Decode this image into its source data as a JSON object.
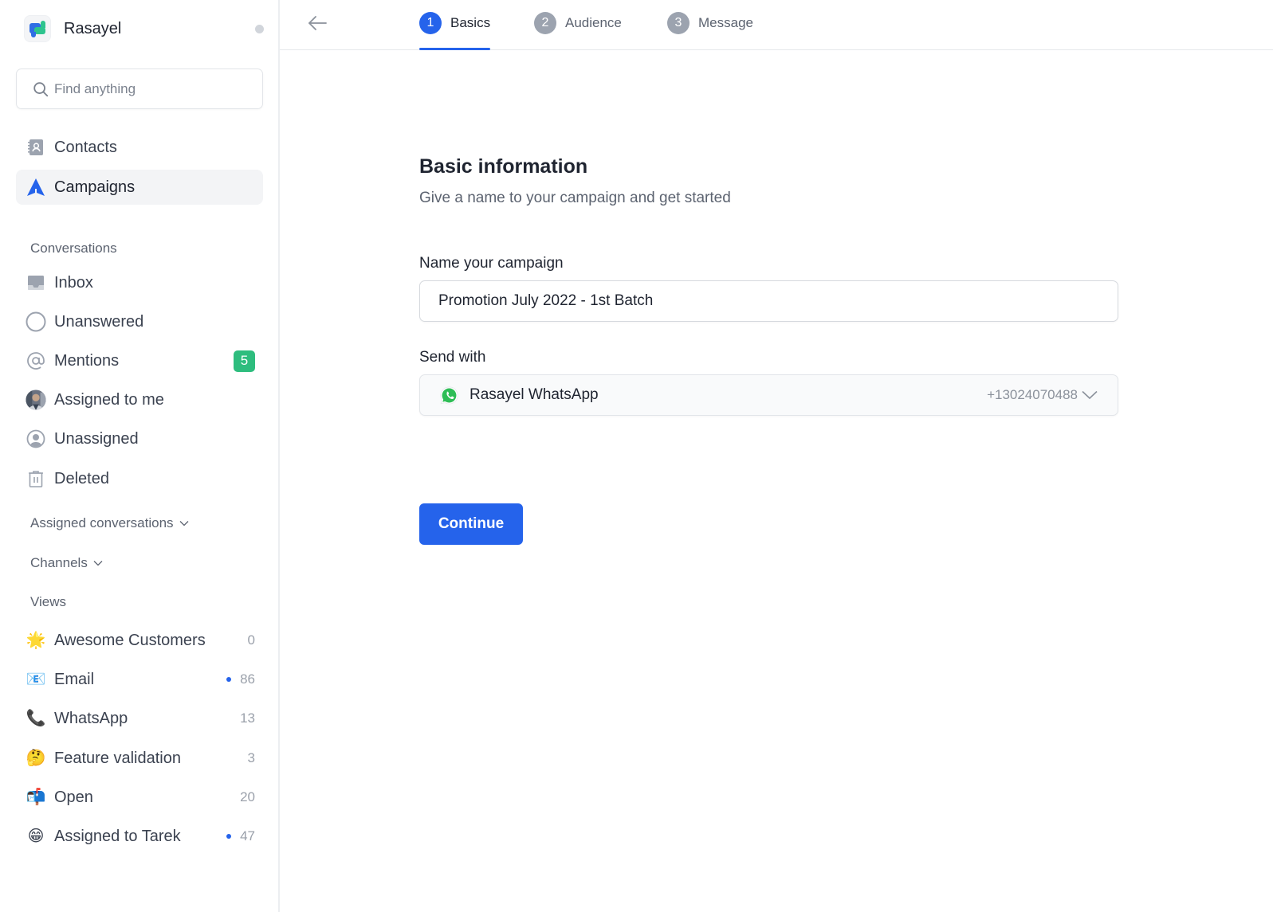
{
  "app": {
    "name": "Rasayel",
    "status": "offline"
  },
  "search": {
    "placeholder": "Find anything"
  },
  "primary_nav": [
    {
      "label": "Contacts",
      "icon": "contacts-icon",
      "active": false
    },
    {
      "label": "Campaigns",
      "icon": "campaigns-icon",
      "active": true
    }
  ],
  "conversations": {
    "heading": "Conversations",
    "items": [
      {
        "label": "Inbox",
        "icon": "inbox-icon"
      },
      {
        "label": "Unanswered",
        "icon": "circle-icon"
      },
      {
        "label": "Mentions",
        "icon": "at-icon",
        "badge": "5"
      },
      {
        "label": "Assigned to me",
        "icon": "avatar-icon"
      },
      {
        "label": "Unassigned",
        "icon": "user-circle-icon"
      },
      {
        "label": "Deleted",
        "icon": "trash-icon"
      }
    ]
  },
  "sections": {
    "assigned_conversations": "Assigned conversations",
    "channels": "Channels",
    "views": "Views"
  },
  "views": [
    {
      "label": "Awesome Customers",
      "emoji": "🌟",
      "count": "0",
      "unread": false
    },
    {
      "label": "Email",
      "emoji": "📧",
      "count": "86",
      "unread": true
    },
    {
      "label": "WhatsApp",
      "emoji": "📞",
      "count": "13",
      "unread": false
    },
    {
      "label": "Feature validation",
      "emoji": "🤔",
      "count": "3",
      "unread": false
    },
    {
      "label": "Open",
      "emoji": "📬",
      "count": "20",
      "unread": false
    },
    {
      "label": "Assigned to Tarek",
      "emoji": "😁",
      "count": "47",
      "unread": true
    }
  ],
  "wizard": {
    "steps": [
      {
        "number": "1",
        "label": "Basics",
        "active": true
      },
      {
        "number": "2",
        "label": "Audience",
        "active": false
      },
      {
        "number": "3",
        "label": "Message",
        "active": false
      }
    ]
  },
  "form": {
    "title": "Basic information",
    "subtitle": "Give a name to your campaign and get started",
    "name_label": "Name your campaign",
    "name_value": "Promotion July 2022 - 1st Batch",
    "send_with_label": "Send with",
    "send_with_value": "Rasayel WhatsApp",
    "send_with_phone": "+13024070488",
    "continue_label": "Continue"
  },
  "colors": {
    "accent": "#2563eb",
    "badge_green": "#2ebd7e",
    "whatsapp_green": "#25d366"
  }
}
